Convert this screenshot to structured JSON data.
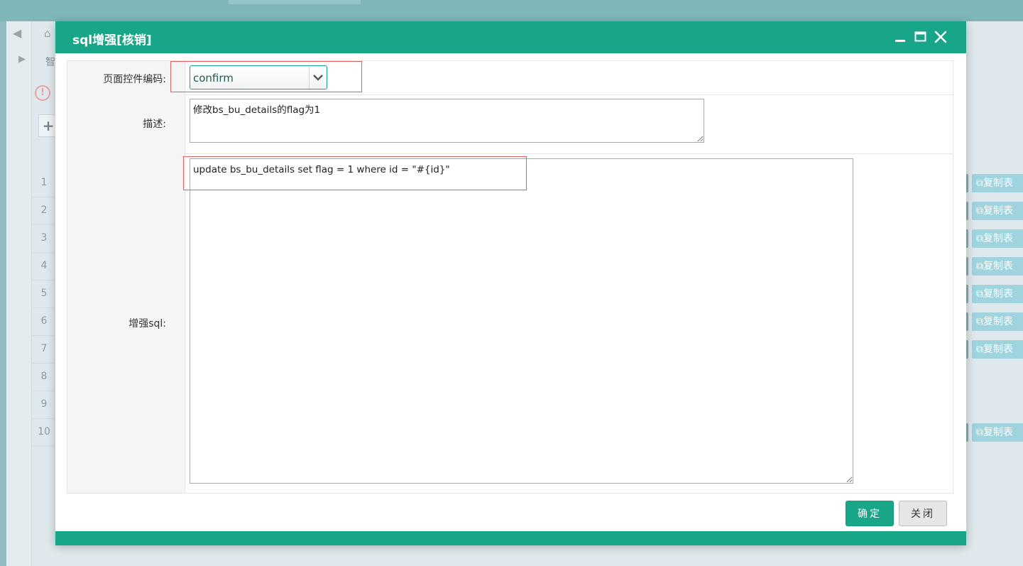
{
  "dialog": {
    "title": "sql增强[核销]",
    "fields": {
      "control_code_label": "页面控件编码:",
      "control_code_value": "confirm",
      "description_label": "描述:",
      "description_value": "修改bs_bu_details的flag为1",
      "sql_label": "增强sql:",
      "sql_value": "update bs_bu_details set flag = 1 where id = \"#{id}\""
    },
    "buttons": {
      "ok": "确定",
      "close": "关闭"
    }
  },
  "background": {
    "fragment_label": "智",
    "row_numbers": [
      "1",
      "2",
      "3",
      "4",
      "5",
      "6",
      "7",
      "8",
      "9",
      "10"
    ],
    "row_action_label": "复制表"
  },
  "icons": {
    "minimize": "minimize-icon",
    "maximize": "maximize-icon",
    "close": "close-icon",
    "dropdown": "chevron-down-icon",
    "copy": "copy-icon",
    "warning": "warning-icon",
    "home": "home-icon",
    "add": "plus-icon"
  },
  "colors": {
    "accent": "#18a689",
    "highlight_box": "#e26060"
  }
}
